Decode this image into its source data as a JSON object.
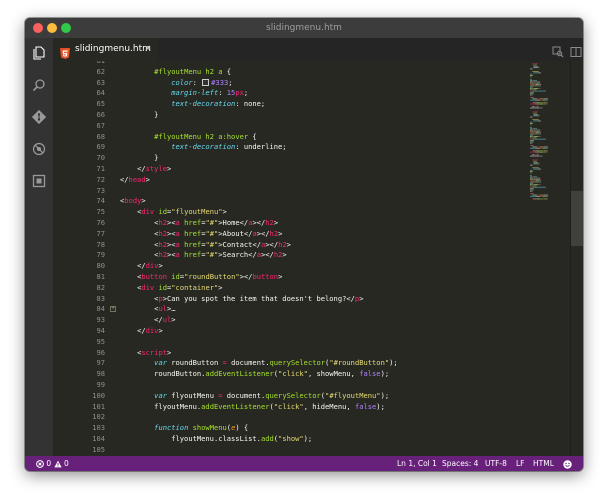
{
  "window": {
    "title": "slidingmenu.htm"
  },
  "tab": {
    "filename": "slidingmenu.htm",
    "close_glyph": "×",
    "icon": "html5-icon"
  },
  "activity_bar": [
    "explorer-icon",
    "search-icon",
    "source-control-icon",
    "debug-icon",
    "extensions-icon"
  ],
  "editor": {
    "first_line_number": 61,
    "lines": [
      {
        "n": "61",
        "t": []
      },
      {
        "n": "62",
        "t": [
          [
            "        ",
            ""
          ],
          [
            "#flyoutMenu h2 a",
            "sel"
          ],
          [
            " {",
            ""
          ]
        ]
      },
      {
        "n": "63",
        "t": [
          [
            "            ",
            ""
          ],
          [
            "color",
            "prop"
          ],
          [
            ": ",
            ""
          ],
          [
            "SWATCH",
            "swatch"
          ],
          [
            "#333",
            "num"
          ],
          [
            ";",
            ""
          ]
        ]
      },
      {
        "n": "64",
        "t": [
          [
            "            ",
            ""
          ],
          [
            "margin-left",
            "prop"
          ],
          [
            ": ",
            ""
          ],
          [
            "15",
            "num"
          ],
          [
            "px",
            "op"
          ],
          [
            ";",
            ""
          ]
        ]
      },
      {
        "n": "65",
        "t": [
          [
            "            ",
            ""
          ],
          [
            "text-decoration",
            "prop"
          ],
          [
            ": none;",
            ""
          ]
        ]
      },
      {
        "n": "66",
        "t": [
          [
            "        }",
            ""
          ]
        ]
      },
      {
        "n": "67",
        "t": []
      },
      {
        "n": "68",
        "t": [
          [
            "        ",
            ""
          ],
          [
            "#flyoutMenu h2 a:hover",
            "sel"
          ],
          [
            " {",
            ""
          ]
        ]
      },
      {
        "n": "69",
        "t": [
          [
            "            ",
            ""
          ],
          [
            "text-decoration",
            "prop"
          ],
          [
            ": underline;",
            ""
          ]
        ]
      },
      {
        "n": "70",
        "t": [
          [
            "        }",
            ""
          ]
        ]
      },
      {
        "n": "71",
        "t": [
          [
            "    </",
            ""
          ],
          [
            "style",
            "tag"
          ],
          [
            ">",
            ""
          ]
        ]
      },
      {
        "n": "72",
        "t": [
          [
            "</",
            ""
          ],
          [
            "head",
            "tag"
          ],
          [
            ">",
            ""
          ]
        ]
      },
      {
        "n": "73",
        "t": []
      },
      {
        "n": "74",
        "t": [
          [
            "<",
            ""
          ],
          [
            "body",
            "tag"
          ],
          [
            ">",
            ""
          ]
        ]
      },
      {
        "n": "75",
        "t": [
          [
            "    <",
            ""
          ],
          [
            "div",
            "tag"
          ],
          [
            " ",
            ""
          ],
          [
            "id",
            "attr"
          ],
          [
            "=",
            ""
          ],
          [
            "\"flyoutMenu\"",
            "str"
          ],
          [
            ">",
            ""
          ]
        ]
      },
      {
        "n": "76",
        "t": [
          [
            "        <",
            ""
          ],
          [
            "h2",
            "tag"
          ],
          [
            "><",
            ""
          ],
          [
            "a",
            "tag"
          ],
          [
            " ",
            ""
          ],
          [
            "href",
            "attr"
          ],
          [
            "=",
            ""
          ],
          [
            "\"#\"",
            "str"
          ],
          [
            ">Home</",
            ""
          ],
          [
            "a",
            "tag"
          ],
          [
            "></",
            ""
          ],
          [
            "h2",
            "tag"
          ],
          [
            ">",
            ""
          ]
        ]
      },
      {
        "n": "77",
        "t": [
          [
            "        <",
            ""
          ],
          [
            "h2",
            "tag"
          ],
          [
            "><",
            ""
          ],
          [
            "a",
            "tag"
          ],
          [
            " ",
            ""
          ],
          [
            "href",
            "attr"
          ],
          [
            "=",
            ""
          ],
          [
            "\"#\"",
            "str"
          ],
          [
            ">About</",
            ""
          ],
          [
            "a",
            "tag"
          ],
          [
            "></",
            ""
          ],
          [
            "h2",
            "tag"
          ],
          [
            ">",
            ""
          ]
        ]
      },
      {
        "n": "78",
        "t": [
          [
            "        <",
            ""
          ],
          [
            "h2",
            "tag"
          ],
          [
            "><",
            ""
          ],
          [
            "a",
            "tag"
          ],
          [
            " ",
            ""
          ],
          [
            "href",
            "attr"
          ],
          [
            "=",
            ""
          ],
          [
            "\"#\"",
            "str"
          ],
          [
            ">Contact</",
            ""
          ],
          [
            "a",
            "tag"
          ],
          [
            "></",
            ""
          ],
          [
            "h2",
            "tag"
          ],
          [
            ">",
            ""
          ]
        ]
      },
      {
        "n": "79",
        "t": [
          [
            "        <",
            ""
          ],
          [
            "h2",
            "tag"
          ],
          [
            "><",
            ""
          ],
          [
            "a",
            "tag"
          ],
          [
            " ",
            ""
          ],
          [
            "href",
            "attr"
          ],
          [
            "=",
            ""
          ],
          [
            "\"#\"",
            "str"
          ],
          [
            ">Search</",
            ""
          ],
          [
            "a",
            "tag"
          ],
          [
            "></",
            ""
          ],
          [
            "h2",
            "tag"
          ],
          [
            ">",
            ""
          ]
        ]
      },
      {
        "n": "80",
        "t": [
          [
            "    </",
            ""
          ],
          [
            "div",
            "tag"
          ],
          [
            ">",
            ""
          ]
        ]
      },
      {
        "n": "81",
        "t": [
          [
            "    <",
            ""
          ],
          [
            "button",
            "tag"
          ],
          [
            " ",
            ""
          ],
          [
            "id",
            "attr"
          ],
          [
            "=",
            ""
          ],
          [
            "\"roundButton\"",
            "str"
          ],
          [
            "></",
            ""
          ],
          [
            "button",
            "tag"
          ],
          [
            ">",
            ""
          ]
        ]
      },
      {
        "n": "82",
        "t": [
          [
            "    <",
            ""
          ],
          [
            "div",
            "tag"
          ],
          [
            " ",
            ""
          ],
          [
            "id",
            "attr"
          ],
          [
            "=",
            ""
          ],
          [
            "\"container\"",
            "str"
          ],
          [
            ">",
            ""
          ]
        ]
      },
      {
        "n": "83",
        "t": [
          [
            "        <",
            ""
          ],
          [
            "p",
            "tag"
          ],
          [
            ">Can you spot the item that doesn't belong?</",
            ""
          ],
          [
            "p",
            "tag"
          ],
          [
            ">",
            ""
          ]
        ]
      },
      {
        "n": "84",
        "t": [
          [
            "        <",
            ""
          ],
          [
            "ul",
            "tag"
          ],
          [
            ">…",
            ""
          ]
        ],
        "fold": "+"
      },
      {
        "n": "93",
        "t": [
          [
            "        </",
            ""
          ],
          [
            "ul",
            "tag"
          ],
          [
            ">",
            ""
          ]
        ]
      },
      {
        "n": "94",
        "t": [
          [
            "    </",
            ""
          ],
          [
            "div",
            "tag"
          ],
          [
            ">",
            ""
          ]
        ]
      },
      {
        "n": "95",
        "t": []
      },
      {
        "n": "96",
        "t": [
          [
            "    <",
            ""
          ],
          [
            "script",
            "tag"
          ],
          [
            ">",
            ""
          ]
        ]
      },
      {
        "n": "97",
        "t": [
          [
            "        ",
            ""
          ],
          [
            "var",
            "kw"
          ],
          [
            " roundButton ",
            ""
          ],
          [
            "=",
            "op"
          ],
          [
            " document.",
            ""
          ],
          [
            "querySelector",
            "fn"
          ],
          [
            "(",
            ""
          ],
          [
            "\"#roundButton\"",
            "str"
          ],
          [
            ");",
            ""
          ]
        ]
      },
      {
        "n": "98",
        "t": [
          [
            "        roundButton.",
            ""
          ],
          [
            "addEventListener",
            "fn"
          ],
          [
            "(",
            ""
          ],
          [
            "\"click\"",
            "str"
          ],
          [
            ", showMenu, ",
            ""
          ],
          [
            "false",
            "const"
          ],
          [
            ");",
            ""
          ]
        ]
      },
      {
        "n": "99",
        "t": []
      },
      {
        "n": "100",
        "t": [
          [
            "        ",
            ""
          ],
          [
            "var",
            "kw"
          ],
          [
            " flyoutMenu ",
            ""
          ],
          [
            "=",
            "op"
          ],
          [
            " document.",
            ""
          ],
          [
            "querySelector",
            "fn"
          ],
          [
            "(",
            ""
          ],
          [
            "\"#flyoutMenu\"",
            "str"
          ],
          [
            ");",
            ""
          ]
        ]
      },
      {
        "n": "101",
        "t": [
          [
            "        flyoutMenu.",
            ""
          ],
          [
            "addEventListener",
            "fn"
          ],
          [
            "(",
            ""
          ],
          [
            "\"click\"",
            "str"
          ],
          [
            ", hideMenu, ",
            ""
          ],
          [
            "false",
            "const"
          ],
          [
            ");",
            ""
          ]
        ]
      },
      {
        "n": "102",
        "t": []
      },
      {
        "n": "103",
        "t": [
          [
            "        ",
            ""
          ],
          [
            "function",
            "kw"
          ],
          [
            " ",
            ""
          ],
          [
            "showMenu",
            "fn"
          ],
          [
            "(",
            ""
          ],
          [
            "e",
            "param"
          ],
          [
            ") {",
            ""
          ]
        ]
      },
      {
        "n": "104",
        "t": [
          [
            "            flyoutMenu.classList.",
            ""
          ],
          [
            "add",
            "fn"
          ],
          [
            "(",
            ""
          ],
          [
            "\"show\"",
            "str"
          ],
          [
            ");",
            ""
          ]
        ]
      },
      {
        "n": "105",
        "t": []
      }
    ]
  },
  "statusbar": {
    "errors": "0",
    "warnings": "0",
    "position": "Ln 1, Col 1",
    "spaces": "Spaces: 4",
    "encoding": "UTF-8",
    "eol": "LF",
    "language": "HTML",
    "feedback_icon": "smiley-icon"
  },
  "colors": {
    "statusbar": "#68217a",
    "editor_bg": "#272822",
    "tag": "#f92672",
    "attr": "#a6e22e",
    "string": "#e6db74",
    "property": "#66d9ef",
    "number": "#ae81ff"
  }
}
